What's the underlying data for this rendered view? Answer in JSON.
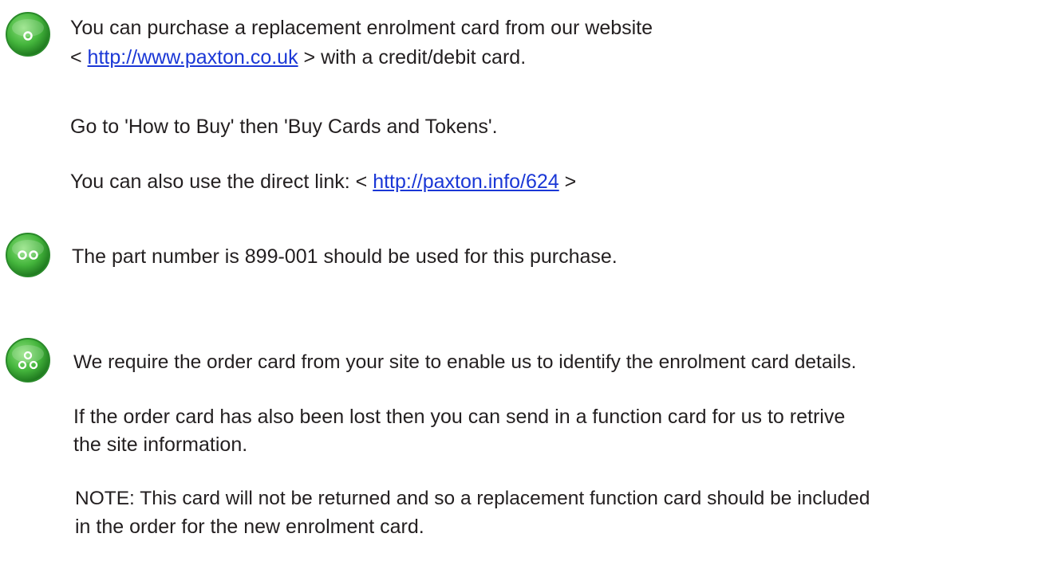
{
  "colors": {
    "text": "#231f20",
    "link": "#1a37d6",
    "icon_green": "#44b53c",
    "icon_dark": "#1f7a1f"
  },
  "steps": [
    {
      "icon": "green-button-one-dot-icon",
      "line1_text": "You can purchase a replacement enrolment card from our website",
      "line2_prefix": "< ",
      "line2_link": "http://www.paxton.co.uk",
      "line2_suffix": " > with a credit/debit card.",
      "para2": "Go to 'How to Buy'  then 'Buy Cards and Tokens'.",
      "para3_prefix": "You can also use the direct link: < ",
      "para3_link": "http://paxton.info/624",
      "para3_suffix": " >"
    },
    {
      "icon": "green-button-two-dots-icon",
      "text": "The part number is 899-001 should be used for this purchase."
    },
    {
      "icon": "green-button-three-dots-icon",
      "line1": "We require the order card from your site to enable us to identify the enrolment card details.",
      "para2_line1": "If the order card has also been lost then you can send in a function card for us to retrive",
      "para2_line2": "the site information.",
      "note_line1": "NOTE: This card will not be returned and so a replacement function card should be included",
      "note_line2": "in the order for the new enrolment card."
    }
  ]
}
